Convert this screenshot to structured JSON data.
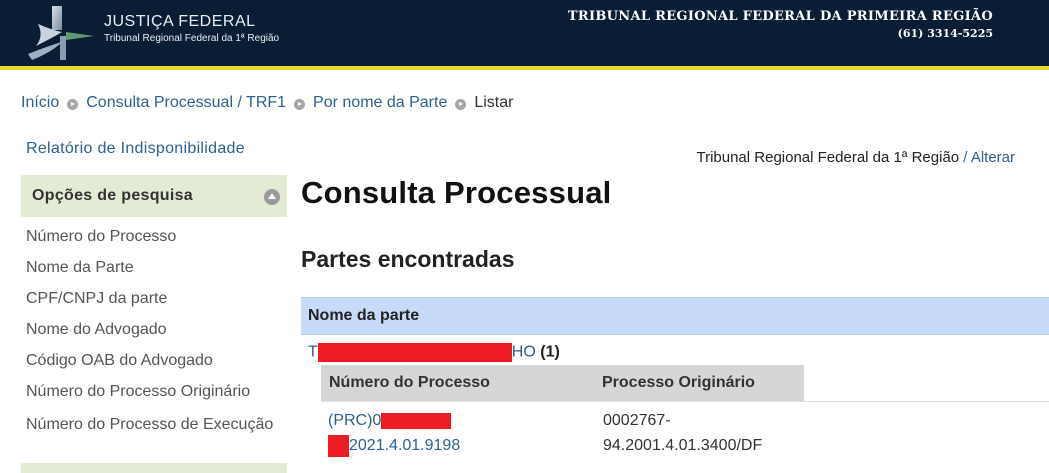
{
  "header": {
    "logo_title": "JUSTIÇA FEDERAL",
    "logo_subtitle": "Tribunal Regional Federal da 1ª Região",
    "court_name": "TRIBUNAL REGIONAL FEDERAL DA PRIMEIRA REGIÃO",
    "phone": "(61) 3314-5225",
    "colors": {
      "background": "#0b1d35",
      "rule": "#e6d92a"
    }
  },
  "breadcrumb": [
    {
      "label": "Início"
    },
    {
      "label": "Consulta Processual / TRF1"
    },
    {
      "label": "Por nome da Parte"
    },
    {
      "label": "Listar"
    }
  ],
  "sidebar": {
    "report_link": "Relatório de Indisponibilidade",
    "panel_title": "Opções de pesquisa",
    "items": [
      {
        "label": "Número do Processo"
      },
      {
        "label": "Nome da Parte"
      },
      {
        "label": "CPF/CNPJ da parte"
      },
      {
        "label": "Nome do Advogado"
      },
      {
        "label": "Código OAB do Advogado"
      },
      {
        "label": "Número do Processo Originário"
      },
      {
        "label": "Número do Processo de Execução"
      }
    ]
  },
  "main": {
    "tribunal_name": "Tribunal Regional Federal da 1ª Região",
    "tribunal_sep": " / ",
    "change_link": "Alterar",
    "title": "Consulta Processual",
    "section_title": "Partes encontradas",
    "parts_table": {
      "header": "Nome da parte",
      "rows": [
        {
          "name_prefix": "T",
          "name_suffix": "HO",
          "count": "(1)",
          "processes_header": [
            "Número do Processo",
            "Processo Originário"
          ],
          "processes": [
            {
              "number_line1": "(PRC)0",
              "number_line2": "2021.4.01.9198",
              "original_line1": "0002767-",
              "original_line2": "94.2001.4.01.3400/DF"
            }
          ]
        }
      ]
    }
  },
  "colors": {
    "link": "#2f5f8f",
    "redaction": "#ec1c24",
    "panel_bg": "#e3ebd4",
    "table_head_bg": "#c7daf7"
  }
}
